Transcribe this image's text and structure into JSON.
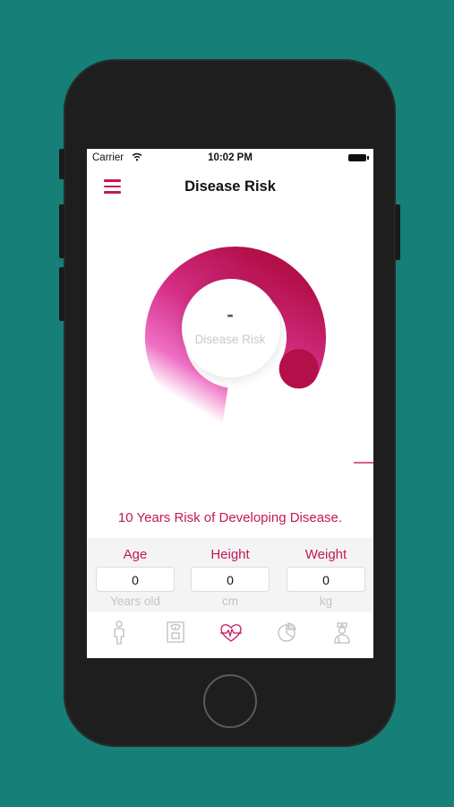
{
  "status_bar": {
    "carrier": "Carrier",
    "time": "10:02 PM",
    "icons": [
      "wifi-icon",
      "battery-icon"
    ]
  },
  "nav": {
    "title": "Disease Risk",
    "menu_icon": "hamburger-menu-icon"
  },
  "gauge": {
    "value": "-",
    "caption": "Disease Risk",
    "arc_fraction": 0.8
  },
  "headline": "10 Years Risk of Developing Disease.",
  "fields": {
    "age": {
      "label": "Age",
      "value": "0",
      "unit": "Years old"
    },
    "height": {
      "label": "Height",
      "value": "0",
      "unit": "cm"
    },
    "weight": {
      "label": "Weight",
      "value": "0",
      "unit": "kg"
    }
  },
  "tabs": [
    {
      "icon": "body-icon",
      "active": false
    },
    {
      "icon": "scale-icon",
      "active": false
    },
    {
      "icon": "heartbeat-icon",
      "active": true
    },
    {
      "icon": "pie-chart-icon",
      "active": false
    },
    {
      "icon": "doctor-icon",
      "active": false
    }
  ],
  "colors": {
    "accent": "#c2185b",
    "background": "#157f78",
    "inactive_icon": "#bdbdbd"
  }
}
